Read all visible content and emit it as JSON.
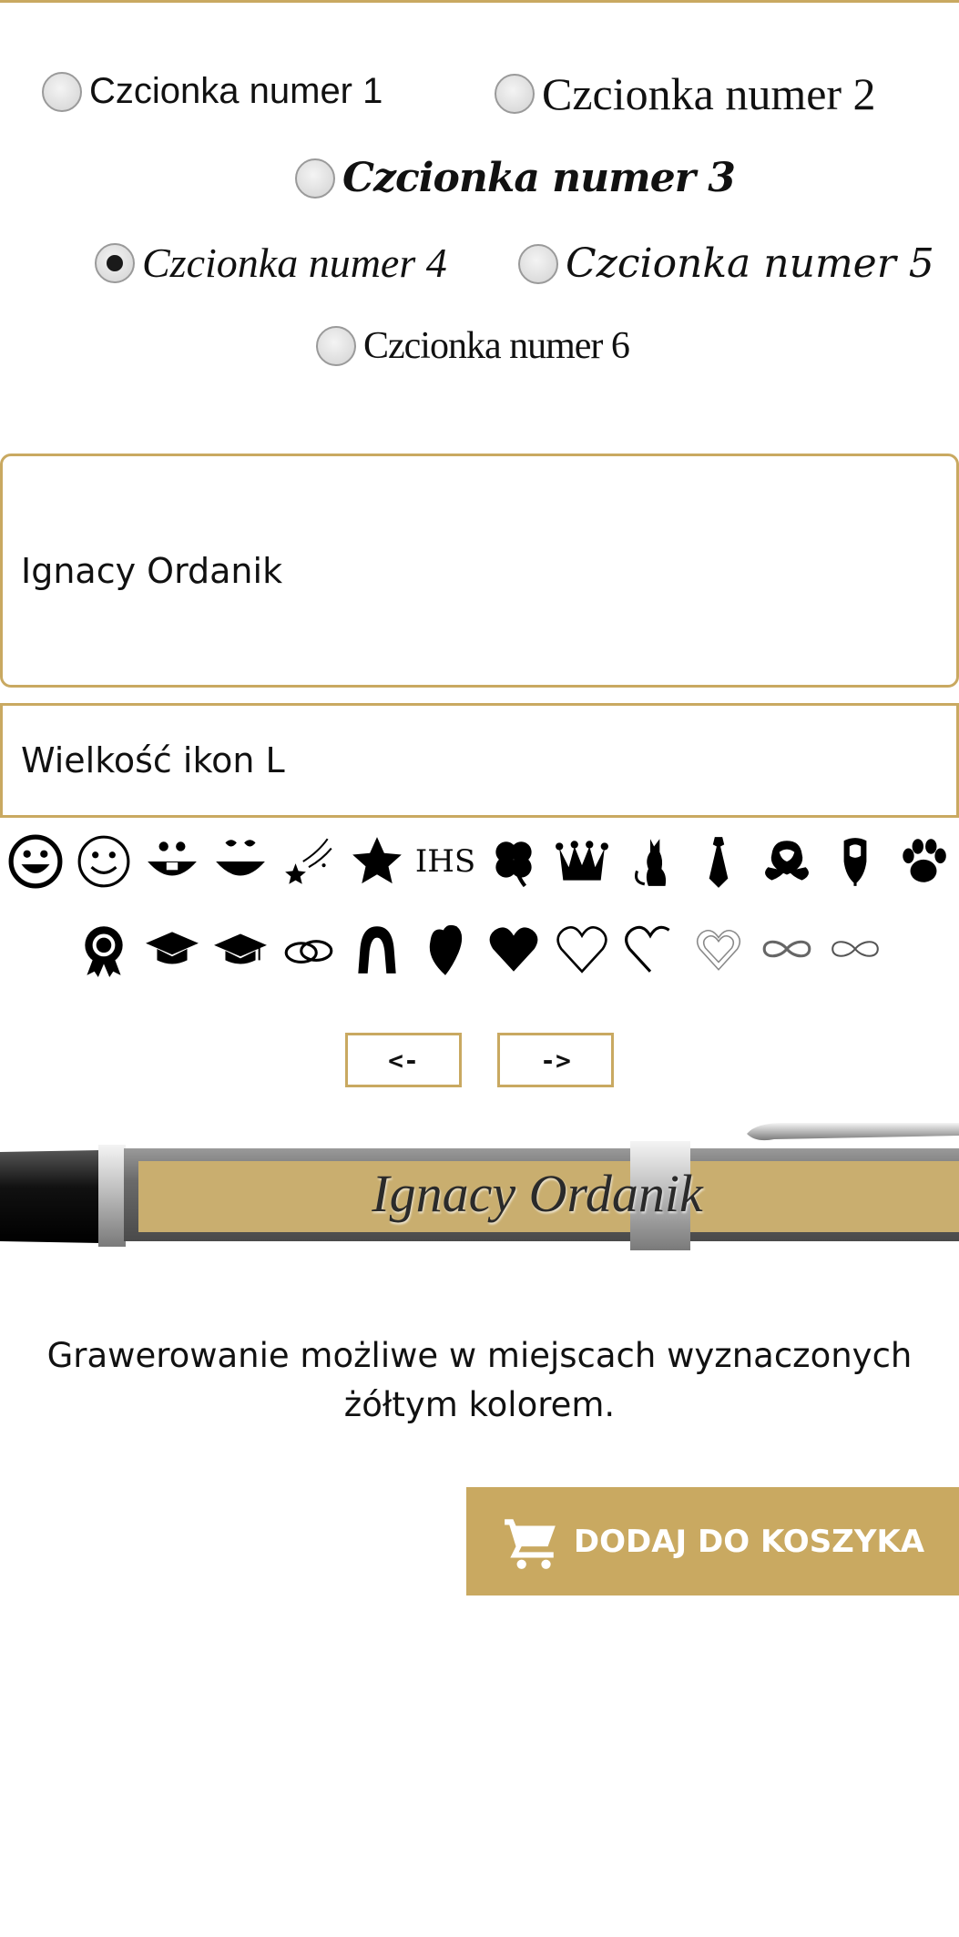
{
  "fonts": {
    "options": [
      {
        "label": "Czcionka numer 1",
        "checked": false
      },
      {
        "label": "Czcionka numer 2",
        "checked": false
      },
      {
        "label": "Czcionka numer 3",
        "checked": false
      },
      {
        "label": "Czcionka numer 4",
        "checked": true
      },
      {
        "label": "Czcionka numer 5",
        "checked": false
      },
      {
        "label": "Czcionka numer 6",
        "checked": false
      }
    ]
  },
  "engraving_text": {
    "value": "Ignacy Ordanik"
  },
  "icon_size": {
    "value": "Wielkość ikon L"
  },
  "icons": {
    "row1": [
      "smiley-big-icon",
      "smiley-outline-icon",
      "smile-teeth-icon",
      "smile-eyes-icon",
      "shooting-star-icon",
      "star-icon",
      "ihs-monogram-icon",
      "four-leaf-clover-icon",
      "crown-icon",
      "cat-icon",
      "necktie-icon",
      "rose-icon",
      "rose-bud-icon",
      "paw-icon"
    ],
    "row2": [
      "rosette-award-icon",
      "graduation-cap-icon",
      "graduation-cap-2-icon",
      "wedding-rings-icon",
      "horseshoe-icon",
      "heart-leaf-icon",
      "heart-filled-icon",
      "heart-outline-icon",
      "heart-half-icon",
      "heart-double-icon",
      "infinity-thick-icon",
      "infinity-icon"
    ],
    "ihs_text": "IHS"
  },
  "pager": {
    "prev_label": "<-",
    "next_label": "->"
  },
  "preview": {
    "engraving": "Ignacy Ordanik"
  },
  "note": {
    "text": "Grawerowanie możliwe w miejscach wyznaczonych żółtym kolorem."
  },
  "cart": {
    "label": "DODAJ DO KOSZYKA"
  },
  "colors": {
    "accent": "#c9a961",
    "engrave_band": "#c9ae6f",
    "pen_body": "#6e6e6e"
  }
}
